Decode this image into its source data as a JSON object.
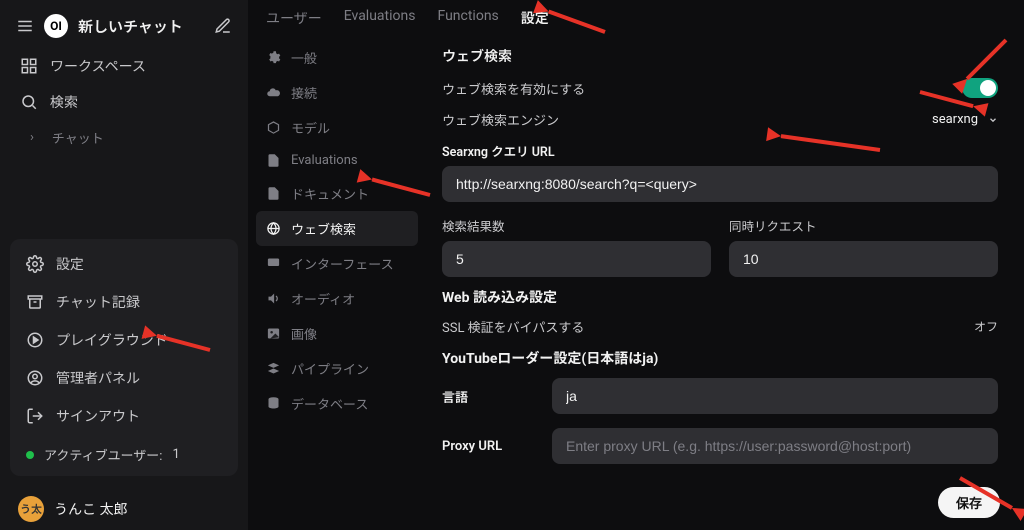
{
  "sidebar": {
    "logo_text": "OI",
    "new_chat": "新しいチャット",
    "items": [
      {
        "id": "workspace",
        "icon": "workspace",
        "label": "ワークスペース"
      },
      {
        "id": "search",
        "icon": "search",
        "label": "検索"
      }
    ],
    "sub_item": "チャット",
    "panel_menu": [
      {
        "id": "settings",
        "icon": "gear",
        "label": "設定"
      },
      {
        "id": "chat-log",
        "icon": "archive",
        "label": "チャット記録"
      },
      {
        "id": "playground",
        "icon": "play-circle",
        "label": "プレイグラウンド"
      },
      {
        "id": "admin",
        "icon": "user-circle",
        "label": "管理者パネル"
      },
      {
        "id": "signout",
        "icon": "signout",
        "label": "サインアウト"
      }
    ],
    "active_users_label": "アクティブユーザー:",
    "active_users_count": "1",
    "user_avatar": "う太",
    "user_name": "うんこ 太郎"
  },
  "tabs": [
    {
      "id": "users",
      "label": "ユーザー",
      "active": false
    },
    {
      "id": "evaluations",
      "label": "Evaluations",
      "active": false
    },
    {
      "id": "functions",
      "label": "Functions",
      "active": false
    },
    {
      "id": "settings",
      "label": "設定",
      "active": true
    }
  ],
  "sections": [
    {
      "id": "general",
      "icon": "gear",
      "label": "一般"
    },
    {
      "id": "connection",
      "icon": "cloud",
      "label": "接続"
    },
    {
      "id": "models",
      "icon": "cube",
      "label": "モデル"
    },
    {
      "id": "evaluations",
      "icon": "doc",
      "label": "Evaluations"
    },
    {
      "id": "documents",
      "icon": "doc",
      "label": "ドキュメント"
    },
    {
      "id": "websearch",
      "icon": "globe",
      "label": "ウェブ検索",
      "active": true
    },
    {
      "id": "interface",
      "icon": "monitor",
      "label": "インターフェース"
    },
    {
      "id": "audio",
      "icon": "speaker",
      "label": "オーディオ"
    },
    {
      "id": "image",
      "icon": "image",
      "label": "画像"
    },
    {
      "id": "pipeline",
      "icon": "stack",
      "label": "パイプライン"
    },
    {
      "id": "database",
      "icon": "database",
      "label": "データベース"
    }
  ],
  "form": {
    "heading_websearch": "ウェブ検索",
    "enable_label": "ウェブ検索を有効にする",
    "enable_value": true,
    "engine_label": "ウェブ検索エンジン",
    "engine_value": "searxng",
    "query_url_label": "Searxng クエリ URL",
    "query_url_value": "http://searxng:8080/search?q=<query>",
    "result_count_label": "検索結果数",
    "result_count_value": "5",
    "concurrent_label": "同時リクエスト",
    "concurrent_value": "10",
    "web_read_heading": "Web 読み込み設定",
    "ssl_bypass_label": "SSL 検証をバイパスする",
    "ssl_bypass_value": "オフ",
    "youtube_heading": "YouTubeローダー設定(日本語はja)",
    "lang_label": "言語",
    "lang_value": "ja",
    "proxy_label": "Proxy URL",
    "proxy_placeholder": "Enter proxy URL (e.g. https://user:password@host:port)",
    "save_label": "保存"
  }
}
